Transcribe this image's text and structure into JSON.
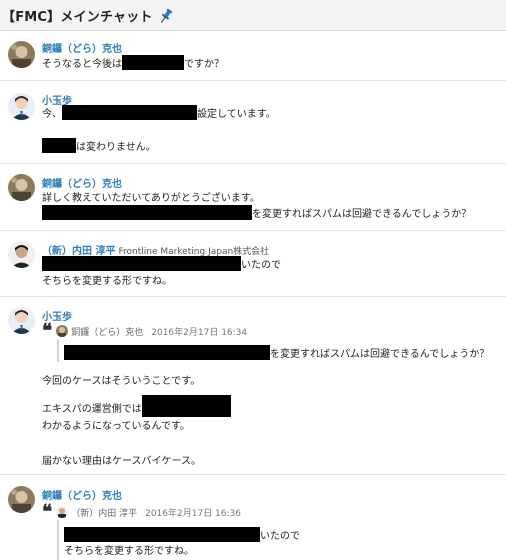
{
  "header": {
    "room_title": "【FMC】メインチャット"
  },
  "messages": [
    {
      "author": "銅鑼（どら）克也",
      "lines": [
        {
          "before": "そうなると今後は",
          "after": "ですか？"
        }
      ]
    },
    {
      "author": "小玉歩",
      "lines": [
        {
          "before": "今、",
          "after": "設定しています。"
        },
        {
          "before": "",
          "after": "は変わりません。"
        }
      ]
    },
    {
      "author": "銅鑼（どら）克也",
      "lines": [
        {
          "text": "詳しく教えていただいてありがとうございます。"
        },
        {
          "before": "",
          "after": "を変更すればスパムは回避できるんでしょうか？"
        }
      ]
    },
    {
      "author": "（新）内田 淳平",
      "company": "Frontline Marketing Japan株式会社",
      "lines": [
        {
          "before": "",
          "after": "いたので"
        },
        {
          "text": "そちらを変更する形ですね。"
        }
      ]
    },
    {
      "author": "小玉歩",
      "quote": {
        "author": "銅鑼（どら）克也",
        "time": "2016年2月17日 16:34"
      },
      "quoted_line": {
        "before": "",
        "after": "を変更すればスパムは回避できるんでしょうか？"
      },
      "lines": [
        {
          "text": "今回のケースはそういうことです。"
        },
        {
          "text": "エキスパの運営側では"
        },
        {
          "text": "わかるようになっているんです。"
        },
        {
          "text": "届かない理由はケースバイケース。"
        }
      ]
    },
    {
      "author": "銅鑼（どら）克也",
      "quote": {
        "author": "（新）内田 淳平",
        "time": "2016年2月17日 16:36"
      },
      "quoted_lines": [
        {
          "before": "",
          "after": "いたので"
        },
        {
          "text": "そちらを変更する形ですね。"
        }
      ]
    }
  ]
}
